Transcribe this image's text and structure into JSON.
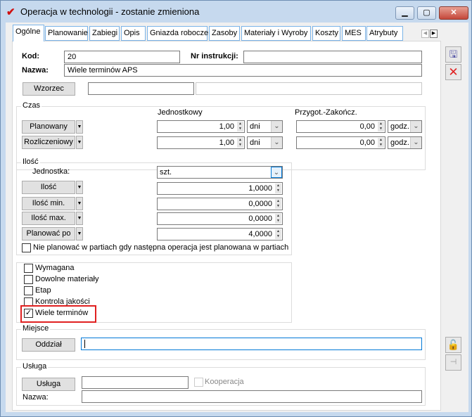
{
  "window": {
    "title": "Operacja w technologii - zostanie zmieniona",
    "minimize": "▁",
    "maximize": "▢",
    "close": "✕"
  },
  "tabs": [
    {
      "label": "Ogólne",
      "active": true
    },
    {
      "label": "Planowanie"
    },
    {
      "label": "Zabiegi"
    },
    {
      "label": "Opis"
    },
    {
      "label": "Gniazda robocze"
    },
    {
      "label": "Zasoby"
    },
    {
      "label": "Materiały i Wyroby"
    },
    {
      "label": "Koszty"
    },
    {
      "label": "MES"
    },
    {
      "label": "Atrybuty"
    }
  ],
  "header": {
    "kod_label": "Kod:",
    "kod_value": "20",
    "nr_label": "Nr instrukcji:",
    "nr_value": "",
    "nazwa_label": "Nazwa:",
    "nazwa_value": "Wiele terminów APS",
    "wzorzec_button": "Wzorzec",
    "wzorzec_code": "",
    "wzorzec_name": ""
  },
  "czas": {
    "label": "Czas",
    "col1": "Jednostkowy",
    "col2": "Przygot.-Zakończ.",
    "rows": [
      {
        "button": "Planowany",
        "v1": "1,00",
        "u1": "dni",
        "v2": "0,00",
        "u2": "godz."
      },
      {
        "button": "Rozliczeniowy",
        "v1": "1,00",
        "u1": "dni",
        "v2": "0,00",
        "u2": "godz."
      }
    ]
  },
  "ilosc": {
    "label": "Ilość",
    "jednostka_label": "Jednostka:",
    "jednostka_value": "szt.",
    "rows": [
      {
        "button": "Ilość",
        "value": "1,0000"
      },
      {
        "button": "Ilość min.",
        "value": "0,0000"
      },
      {
        "button": "Ilość max.",
        "value": "0,0000"
      },
      {
        "button": "Planować po",
        "value": "4,0000"
      }
    ],
    "nie_planowac": {
      "label": "Nie planować w partiach gdy następna operacja jest planowana w partiach",
      "checked": false
    }
  },
  "flags": [
    {
      "label": "Wymagana",
      "checked": false
    },
    {
      "label": "Dowolne materiały",
      "checked": false
    },
    {
      "label": "Etap",
      "checked": false
    },
    {
      "label": "Kontrola jakości",
      "checked": false
    },
    {
      "label": "Wiele terminów",
      "checked": true,
      "highlighted": true
    }
  ],
  "miejsce": {
    "label": "Miejsce",
    "button": "Oddział",
    "value": ""
  },
  "usluga": {
    "label": "Usługa",
    "button": "Usługa",
    "code": "",
    "kooperacja": "Kooperacja",
    "kooperacja_checked": false,
    "nazwa_label": "Nazwa:",
    "nazwa_value": ""
  },
  "colors": {
    "highlight": "#e02020",
    "tab_border": "#7ab3e8",
    "focus": "#0078d7"
  },
  "icons": {
    "save": "save-icon",
    "delete": "delete-icon",
    "lock": "unlock-icon",
    "pin": "pin-icon"
  }
}
